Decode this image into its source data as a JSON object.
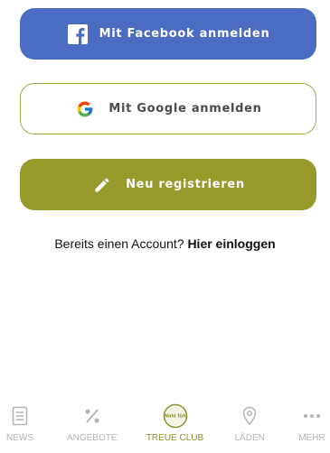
{
  "buttons": {
    "facebook_label": "Mit Facebook anmelden",
    "google_label": "Mit Google anmelden",
    "register_label": "Neu registrieren"
  },
  "login": {
    "prompt": "Bereits einen Account?",
    "link": "Hier einloggen"
  },
  "tabbar": {
    "items": [
      {
        "label": "NEWS",
        "icon": "news-icon",
        "active": false
      },
      {
        "label": "ANGEBOTE",
        "icon": "percent-icon",
        "active": false
      },
      {
        "label": "TREUE CLUB",
        "icon": "treue-club-logo-icon",
        "active": true
      },
      {
        "label": "LÄDEN",
        "icon": "location-pin-icon",
        "active": false
      },
      {
        "label": "MEHR",
        "icon": "more-dots-icon",
        "active": false
      }
    ],
    "logo_text": "Wohl fühl"
  },
  "colors": {
    "facebook_blue": "#4a6cc2",
    "brand_olive": "#959a2b",
    "google_border": "#a6a84a",
    "tab_inactive": "#b5b5b5",
    "tab_active": "#8c912a"
  }
}
